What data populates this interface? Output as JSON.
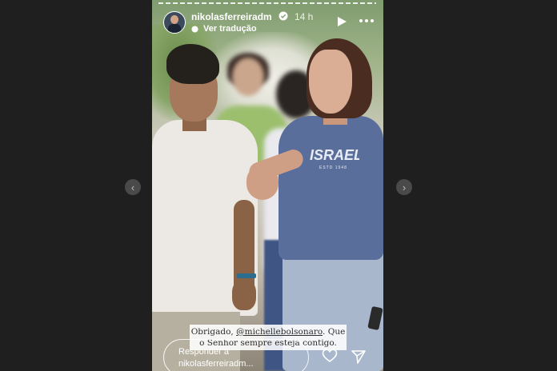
{
  "story": {
    "username": "nikolasferreiradm",
    "time_ago": "14 h",
    "translate_label": "Ver tradução",
    "caption": {
      "prefix": "Obrigado, ",
      "mention": "@michellebolsonaro",
      "suffix": ". Que o Senhor sempre esteja contigo."
    },
    "reply_placeholder": "Responder a nikolasferreiradm...",
    "shirt_logo_text": "ISRAEL",
    "shirt_logo_subtext": "ESTD 1948"
  },
  "icons": {
    "prev": "chevron-left-icon",
    "next": "chevron-right-icon",
    "verified": "verified-badge-icon",
    "translate": "globe-icon",
    "play": "play-icon",
    "more": "more-dots-icon",
    "heart": "heart-icon",
    "send": "send-icon"
  },
  "colors": {
    "page_background": "#1f1f1f",
    "verified_badge": "#ffffff",
    "accent_text": "#ffffff"
  }
}
